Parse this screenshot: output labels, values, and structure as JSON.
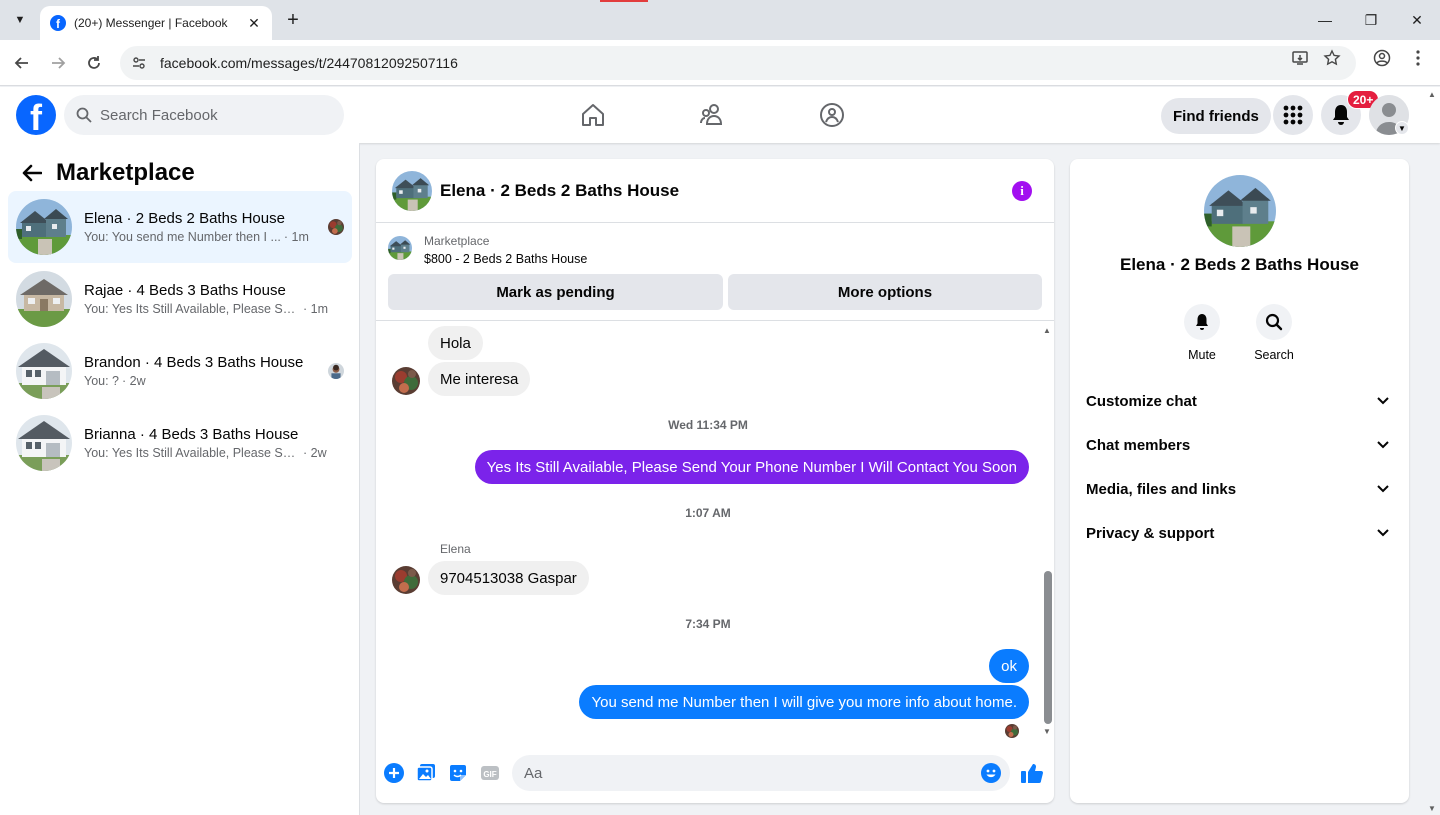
{
  "browser": {
    "tab_title": "(20+) Messenger | Facebook",
    "url": "facebook.com/messages/t/24470812092507116"
  },
  "header": {
    "search_placeholder": "Search Facebook",
    "find_friends_label": "Find friends",
    "notification_count": "20+",
    "brand_color": "#0866ff"
  },
  "sidebar": {
    "title": "Marketplace",
    "conversations": [
      {
        "name": "Elena · 2 Beds 2 Baths House",
        "snippet": "You: You send me Number then I ...",
        "time": "· 1m",
        "active": true
      },
      {
        "name": "Rajae · 4 Beds 3 Baths House",
        "snippet": "You: Yes Its Still Available, Please Sen...",
        "time": "· 1m",
        "active": false
      },
      {
        "name": "Brandon · 4 Beds 3 Baths House",
        "snippet": "You: ?",
        "time": "· 2w",
        "active": false
      },
      {
        "name": "Brianna · 4 Beds 3 Baths House",
        "snippet": "You: Yes Its Still Available, Please Send...",
        "time": "· 2w",
        "active": false
      }
    ]
  },
  "chat": {
    "contact_name": "Elena · 2 Beds 2 Baths House",
    "listing": {
      "label": "Marketplace",
      "price_title": "$800 - 2 Beds 2 Baths House",
      "mark_pending_label": "Mark as pending",
      "more_options_label": "More options"
    },
    "messages": [
      {
        "text": "Hola"
      },
      {
        "text": "Me interesa"
      },
      {
        "timestamp": "Wed 11:34 PM"
      },
      {
        "text": "Yes Its Still Available, Please Send Your Phone Number I Will Contact You Soon"
      },
      {
        "timestamp": "1:07 AM"
      },
      {
        "sender": "Elena"
      },
      {
        "text": "9704513038 Gaspar"
      },
      {
        "timestamp": "7:34 PM"
      },
      {
        "text": "ok"
      },
      {
        "text": "You send me Number then I will give you more info about home."
      }
    ],
    "composer_placeholder": "Aa",
    "colors": {
      "outgoing_purple": "#7b23ea",
      "outgoing_blue": "#0a7cff",
      "incoming": "#f0f0f0",
      "info_icon": "#a20ff0"
    }
  },
  "info_panel": {
    "name": "Elena · 2 Beds 2 Baths House",
    "actions": [
      {
        "label": "Mute",
        "icon": "bell-icon"
      },
      {
        "label": "Search",
        "icon": "search-icon"
      }
    ],
    "sections": [
      {
        "label": "Customize chat"
      },
      {
        "label": "Chat members"
      },
      {
        "label": "Media, files and links"
      },
      {
        "label": "Privacy & support"
      }
    ]
  }
}
